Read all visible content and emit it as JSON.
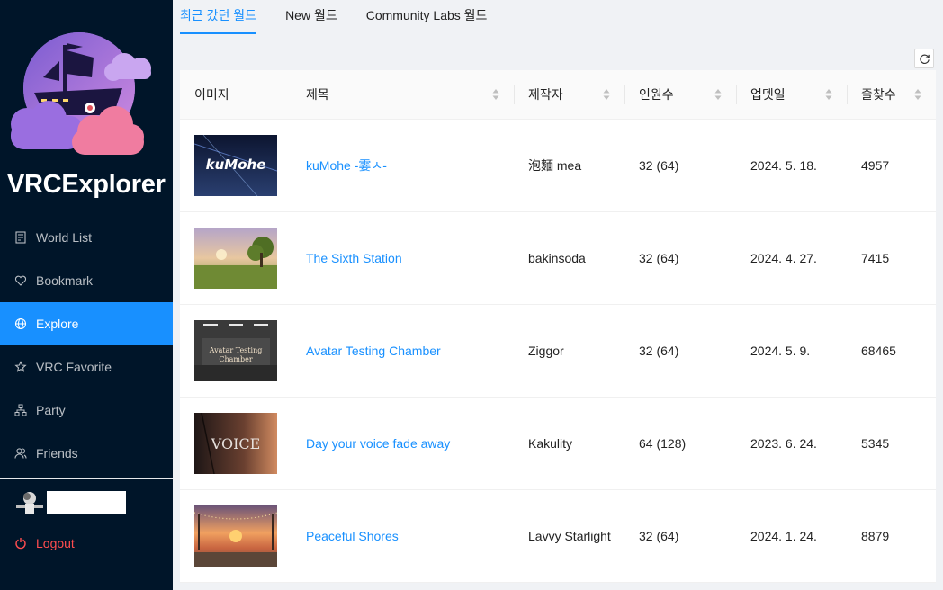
{
  "app": {
    "brand": "VRCExplorer"
  },
  "sidebar": {
    "items": [
      {
        "label": "World List",
        "icon": "file-list-icon",
        "active": false
      },
      {
        "label": "Bookmark",
        "icon": "heart-icon",
        "active": false
      },
      {
        "label": "Explore",
        "icon": "globe-icon",
        "active": true
      },
      {
        "label": "VRC Favorite",
        "icon": "star-icon",
        "active": false
      },
      {
        "label": "Party",
        "icon": "cluster-icon",
        "active": false
      },
      {
        "label": "Friends",
        "icon": "users-icon",
        "active": false
      }
    ],
    "logout_label": "Logout"
  },
  "tabs": [
    {
      "label": "최근 갔던 월드",
      "active": true
    },
    {
      "label": "New 월드",
      "active": false
    },
    {
      "label": "Community Labs 월드",
      "active": false
    }
  ],
  "table": {
    "columns": [
      "이미지",
      "제목",
      "제작자",
      "인원수",
      "업뎃일",
      "즐찾수"
    ],
    "rows": [
      {
        "title": "kuMohe -霎ㅅ-",
        "author": "泡麵 mea",
        "capacity": "32 (64)",
        "updated": "2024. 5. 18.",
        "favorites": "4957",
        "thumb_text": "kuMohe",
        "thumb_theme": "kumohe"
      },
      {
        "title": "The Sixth Station",
        "author": "bakinsoda",
        "capacity": "32 (64)",
        "updated": "2024. 4. 27.",
        "favorites": "7415",
        "thumb_text": "",
        "thumb_theme": "field"
      },
      {
        "title": "Avatar Testing Chamber",
        "author": "Ziggor",
        "capacity": "32 (64)",
        "updated": "2024. 5. 9.",
        "favorites": "68465",
        "thumb_text": "Avatar Testing Chamber",
        "thumb_theme": "chamber"
      },
      {
        "title": "Day your voice fade away",
        "author": "Kakulity",
        "capacity": "64 (128)",
        "updated": "2023. 6. 24.",
        "favorites": "5345",
        "thumb_text": "VOICE",
        "thumb_theme": "voice"
      },
      {
        "title": "Peaceful Shores",
        "author": "Lavvy Starlight",
        "capacity": "32 (64)",
        "updated": "2024. 1. 24.",
        "favorites": "8879",
        "thumb_text": "",
        "thumb_theme": "shores"
      }
    ]
  },
  "colors": {
    "sidebar_bg": "#001529",
    "accent": "#1890ff",
    "danger": "#ff4d4f"
  }
}
